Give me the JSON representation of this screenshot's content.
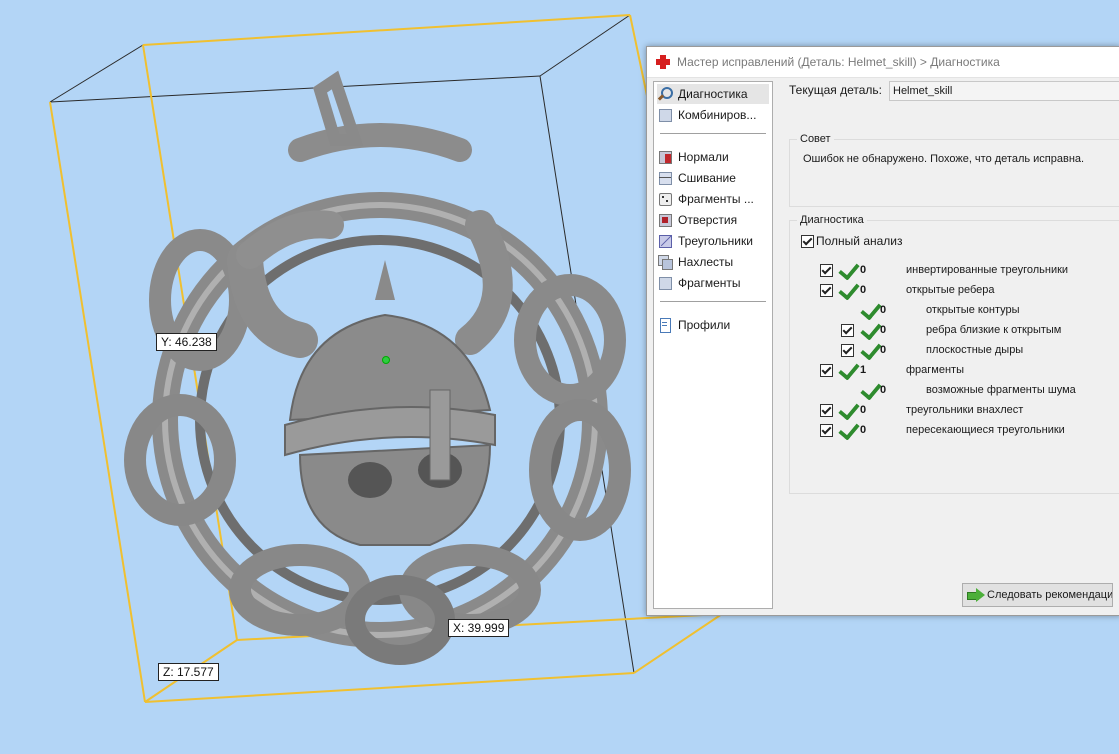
{
  "viewport": {
    "dim_y": "Y: 46.238",
    "dim_x": "X: 39.999",
    "dim_z": "Z: 17.577"
  },
  "dialog": {
    "title": "Мастер исправлений (Деталь: Helmet_skill) > Диагностика",
    "nav": {
      "items": [
        {
          "label": "Диагностика",
          "icon": "magnifier-icon"
        },
        {
          "label": "Комбиниров...",
          "icon": "cube-icon"
        },
        {
          "label": "Нормали",
          "icon": "normals-icon"
        },
        {
          "label": "Сшивание",
          "icon": "stitch-icon"
        },
        {
          "label": "Фрагменты ...",
          "icon": "dice-icon"
        },
        {
          "label": "Отверстия",
          "icon": "holes-icon"
        },
        {
          "label": "Треугольники",
          "icon": "triangles-icon"
        },
        {
          "label": "Нахлесты",
          "icon": "overlap-icon"
        },
        {
          "label": "Фрагменты",
          "icon": "shells-icon"
        },
        {
          "label": "Профили",
          "icon": "document-icon"
        }
      ]
    },
    "current_part_label": "Текущая деталь:",
    "current_part_value": "Helmet_skill",
    "advice": {
      "title": "Совет",
      "text": "Ошибок не обнаружено. Похоже, что деталь исправна."
    },
    "diagnostics": {
      "title": "Диагностика",
      "full_analysis": "Полный анализ",
      "rows": [
        {
          "count": "0",
          "label": "инвертированные треугольники"
        },
        {
          "count": "0",
          "label": "открытые ребера"
        },
        {
          "count": "0",
          "label": "открытые контуры"
        },
        {
          "count": "0",
          "label": "ребра близкие к открытым"
        },
        {
          "count": "0",
          "label": "плоскостные дыры"
        },
        {
          "count": "1",
          "label": "фрагменты"
        },
        {
          "count": "0",
          "label": "возможные фрагменты шума"
        },
        {
          "count": "0",
          "label": "треугольники внахлест"
        },
        {
          "count": "0",
          "label": "пересекающиеся треугольники"
        }
      ]
    },
    "follow_button": "Следовать рекомендациям"
  }
}
